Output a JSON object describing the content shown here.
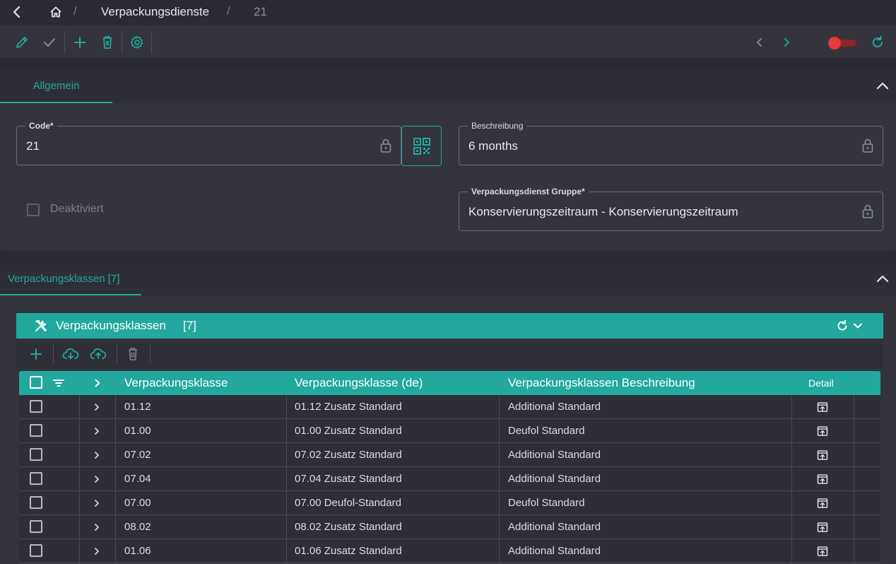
{
  "breadcrumb": {
    "items": [
      "Verpackungsdienste",
      "21"
    ],
    "separator": "/"
  },
  "toolbar": {
    "icons": [
      "edit-icon",
      "check-icon",
      "add-icon",
      "delete-icon",
      "settings-icon",
      "prev-icon",
      "next-icon",
      "toggle",
      "refresh-icon"
    ]
  },
  "general": {
    "tab_label": "Allgemein",
    "code": {
      "label": "Code*",
      "value": "21"
    },
    "beschreibung": {
      "label": "Beschreibung",
      "value": "6 months"
    },
    "gruppe": {
      "label": "Verpackungsdienst Gruppe*",
      "value": "Konservierungszeitraum - Konservierungszeitraum"
    },
    "deaktiviert": {
      "label": "Deaktiviert",
      "checked": false
    }
  },
  "classes": {
    "tab_label": "Verpackungsklassen [7]",
    "grid_title": "Verpackungsklassen",
    "grid_count": "[7]",
    "columns": [
      "Verpackungsklasse",
      "Verpackungsklasse (de)",
      "Verpackungsklassen Beschreibung",
      "Detail"
    ],
    "rows": [
      {
        "klasse": "01.12",
        "klasse_de": "01.12 Zusatz Standard",
        "beschreibung": "Additional Standard"
      },
      {
        "klasse": "01.00",
        "klasse_de": "01.00 Zusatz Standard",
        "beschreibung": "Deufol Standard"
      },
      {
        "klasse": "07.02",
        "klasse_de": "07.02 Zusatz Standard",
        "beschreibung": "Additional Standard"
      },
      {
        "klasse": "07.04",
        "klasse_de": "07.04 Zusatz Standard",
        "beschreibung": "Additional Standard"
      },
      {
        "klasse": "07.00",
        "klasse_de": "07.00 Deufol-Standard",
        "beschreibung": "Deufol Standard"
      },
      {
        "klasse": "08.02",
        "klasse_de": "08.02 Zusatz Standard",
        "beschreibung": "Additional Standard"
      },
      {
        "klasse": "01.06",
        "klasse_de": "01.06 Zusatz Standard",
        "beschreibung": "Additional Standard"
      }
    ]
  },
  "colors": {
    "accent": "#22a89d",
    "toggle_off": "#e53935",
    "background": "#2b2c33"
  }
}
